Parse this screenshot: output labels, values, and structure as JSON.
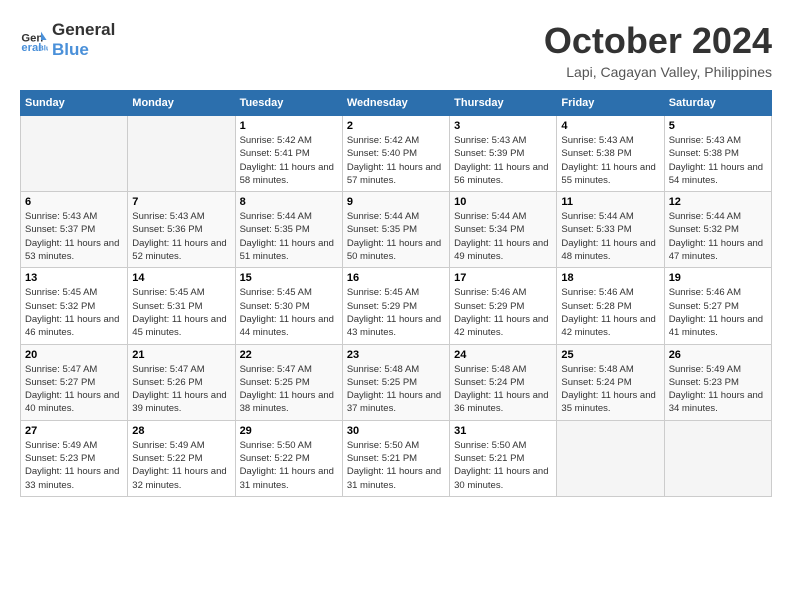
{
  "logo": {
    "line1": "General",
    "line2": "Blue"
  },
  "title": "October 2024",
  "location": "Lapi, Cagayan Valley, Philippines",
  "weekdays": [
    "Sunday",
    "Monday",
    "Tuesday",
    "Wednesday",
    "Thursday",
    "Friday",
    "Saturday"
  ],
  "weeks": [
    [
      {
        "day": "",
        "info": ""
      },
      {
        "day": "",
        "info": ""
      },
      {
        "day": "1",
        "info": "Sunrise: 5:42 AM\nSunset: 5:41 PM\nDaylight: 11 hours and 58 minutes."
      },
      {
        "day": "2",
        "info": "Sunrise: 5:42 AM\nSunset: 5:40 PM\nDaylight: 11 hours and 57 minutes."
      },
      {
        "day": "3",
        "info": "Sunrise: 5:43 AM\nSunset: 5:39 PM\nDaylight: 11 hours and 56 minutes."
      },
      {
        "day": "4",
        "info": "Sunrise: 5:43 AM\nSunset: 5:38 PM\nDaylight: 11 hours and 55 minutes."
      },
      {
        "day": "5",
        "info": "Sunrise: 5:43 AM\nSunset: 5:38 PM\nDaylight: 11 hours and 54 minutes."
      }
    ],
    [
      {
        "day": "6",
        "info": "Sunrise: 5:43 AM\nSunset: 5:37 PM\nDaylight: 11 hours and 53 minutes."
      },
      {
        "day": "7",
        "info": "Sunrise: 5:43 AM\nSunset: 5:36 PM\nDaylight: 11 hours and 52 minutes."
      },
      {
        "day": "8",
        "info": "Sunrise: 5:44 AM\nSunset: 5:35 PM\nDaylight: 11 hours and 51 minutes."
      },
      {
        "day": "9",
        "info": "Sunrise: 5:44 AM\nSunset: 5:35 PM\nDaylight: 11 hours and 50 minutes."
      },
      {
        "day": "10",
        "info": "Sunrise: 5:44 AM\nSunset: 5:34 PM\nDaylight: 11 hours and 49 minutes."
      },
      {
        "day": "11",
        "info": "Sunrise: 5:44 AM\nSunset: 5:33 PM\nDaylight: 11 hours and 48 minutes."
      },
      {
        "day": "12",
        "info": "Sunrise: 5:44 AM\nSunset: 5:32 PM\nDaylight: 11 hours and 47 minutes."
      }
    ],
    [
      {
        "day": "13",
        "info": "Sunrise: 5:45 AM\nSunset: 5:32 PM\nDaylight: 11 hours and 46 minutes."
      },
      {
        "day": "14",
        "info": "Sunrise: 5:45 AM\nSunset: 5:31 PM\nDaylight: 11 hours and 45 minutes."
      },
      {
        "day": "15",
        "info": "Sunrise: 5:45 AM\nSunset: 5:30 PM\nDaylight: 11 hours and 44 minutes."
      },
      {
        "day": "16",
        "info": "Sunrise: 5:45 AM\nSunset: 5:29 PM\nDaylight: 11 hours and 43 minutes."
      },
      {
        "day": "17",
        "info": "Sunrise: 5:46 AM\nSunset: 5:29 PM\nDaylight: 11 hours and 42 minutes."
      },
      {
        "day": "18",
        "info": "Sunrise: 5:46 AM\nSunset: 5:28 PM\nDaylight: 11 hours and 42 minutes."
      },
      {
        "day": "19",
        "info": "Sunrise: 5:46 AM\nSunset: 5:27 PM\nDaylight: 11 hours and 41 minutes."
      }
    ],
    [
      {
        "day": "20",
        "info": "Sunrise: 5:47 AM\nSunset: 5:27 PM\nDaylight: 11 hours and 40 minutes."
      },
      {
        "day": "21",
        "info": "Sunrise: 5:47 AM\nSunset: 5:26 PM\nDaylight: 11 hours and 39 minutes."
      },
      {
        "day": "22",
        "info": "Sunrise: 5:47 AM\nSunset: 5:25 PM\nDaylight: 11 hours and 38 minutes."
      },
      {
        "day": "23",
        "info": "Sunrise: 5:48 AM\nSunset: 5:25 PM\nDaylight: 11 hours and 37 minutes."
      },
      {
        "day": "24",
        "info": "Sunrise: 5:48 AM\nSunset: 5:24 PM\nDaylight: 11 hours and 36 minutes."
      },
      {
        "day": "25",
        "info": "Sunrise: 5:48 AM\nSunset: 5:24 PM\nDaylight: 11 hours and 35 minutes."
      },
      {
        "day": "26",
        "info": "Sunrise: 5:49 AM\nSunset: 5:23 PM\nDaylight: 11 hours and 34 minutes."
      }
    ],
    [
      {
        "day": "27",
        "info": "Sunrise: 5:49 AM\nSunset: 5:23 PM\nDaylight: 11 hours and 33 minutes."
      },
      {
        "day": "28",
        "info": "Sunrise: 5:49 AM\nSunset: 5:22 PM\nDaylight: 11 hours and 32 minutes."
      },
      {
        "day": "29",
        "info": "Sunrise: 5:50 AM\nSunset: 5:22 PM\nDaylight: 11 hours and 31 minutes."
      },
      {
        "day": "30",
        "info": "Sunrise: 5:50 AM\nSunset: 5:21 PM\nDaylight: 11 hours and 31 minutes."
      },
      {
        "day": "31",
        "info": "Sunrise: 5:50 AM\nSunset: 5:21 PM\nDaylight: 11 hours and 30 minutes."
      },
      {
        "day": "",
        "info": ""
      },
      {
        "day": "",
        "info": ""
      }
    ]
  ]
}
